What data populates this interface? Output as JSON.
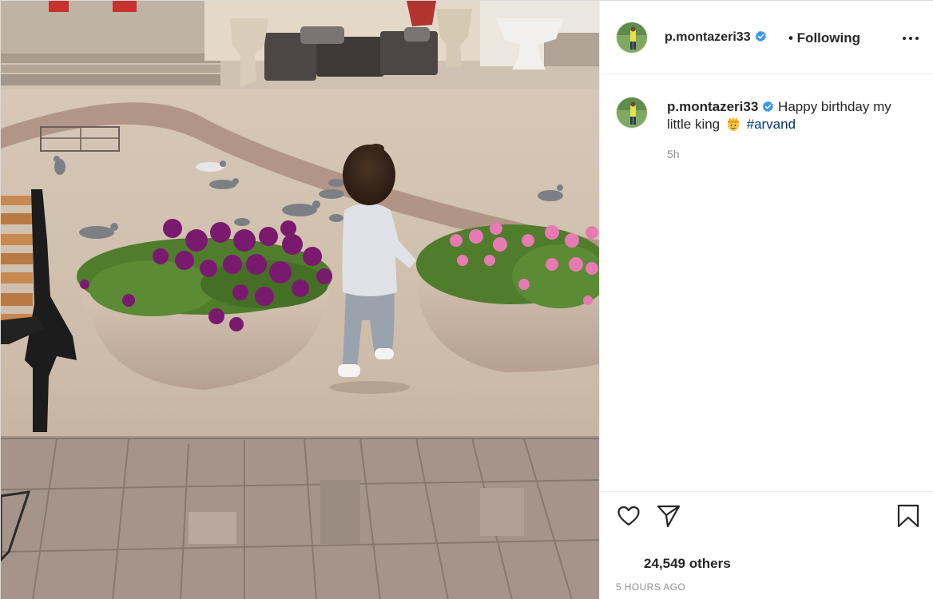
{
  "post": {
    "photo": {
      "description_icon": "post-photo"
    },
    "header": {
      "username": "p.montazeri33",
      "follow_state": "• Following",
      "verified_icon": "verified-badge-icon",
      "more_icon": "more-options-icon"
    },
    "caption": {
      "username": "p.montazeri33",
      "text_before": "Happy birthday my little king",
      "emoji_icon": "prince-emoji-icon",
      "hashtag": "#arvand",
      "time_ago": "5h"
    },
    "actions": {
      "like_icon": "heart-icon",
      "share_icon": "paper-plane-icon",
      "save_icon": "bookmark-icon",
      "likes_text": "24,549 others",
      "timestamp": "5 HOURS AGO"
    }
  },
  "colors": {
    "text": "#262626",
    "secondary": "#8e8e8e",
    "link": "#00376b",
    "verified": "#3897f0",
    "border": "#efefef"
  }
}
